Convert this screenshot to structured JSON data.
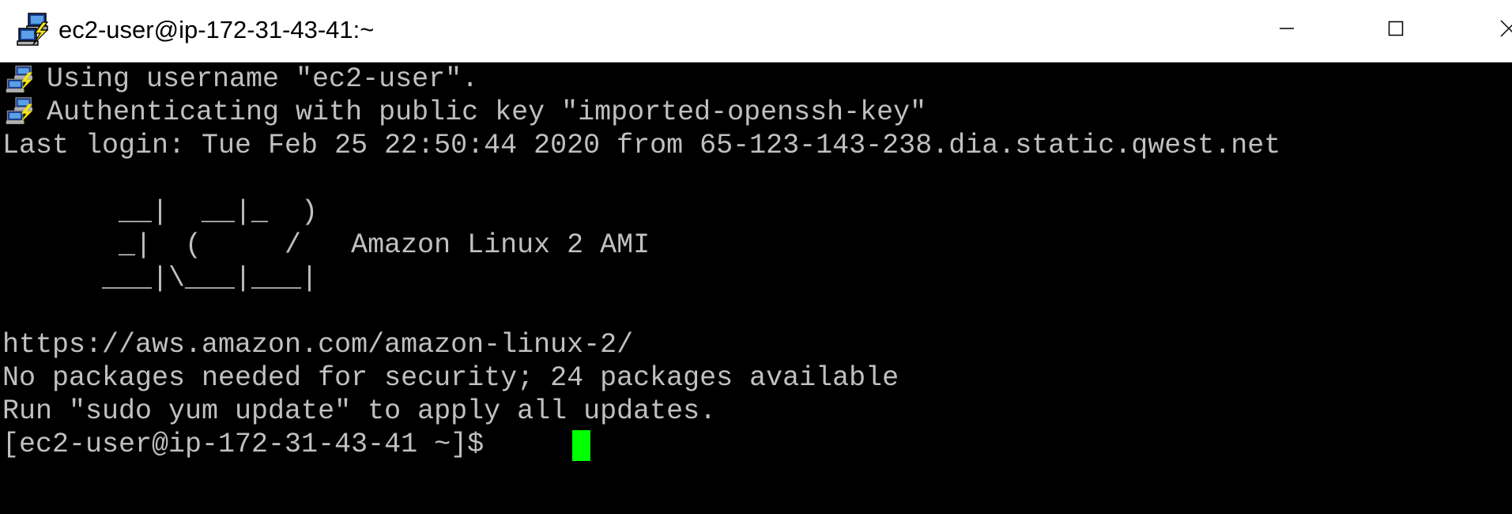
{
  "window": {
    "title": "ec2-user@ip-172-31-43-41:~",
    "app_icon": "putty-icon",
    "controls": {
      "minimize": "minimize-icon",
      "maximize": "maximize-icon",
      "close": "close-icon"
    }
  },
  "terminal": {
    "lines": [
      " Using username \"ec2-user\".",
      " Authenticating with public key \"imported-openssh-key\"",
      "Last login: Tue Feb 25 22:50:44 2020 from 65-123-143-238.dia.static.qwest.net",
      "",
      "       __|  __|_  )",
      "       _|  (     /   Amazon Linux 2 AMI",
      "      ___|\\___|___|",
      "",
      "https://aws.amazon.com/amazon-linux-2/",
      "No packages needed for security; 24 packages available",
      "Run \"sudo yum update\" to apply all updates.",
      "[ec2-user@ip-172-31-43-41 ~]$ "
    ],
    "colors": {
      "background": "#000000",
      "foreground": "#c0c0c0",
      "cursor": "#00ff00"
    }
  }
}
